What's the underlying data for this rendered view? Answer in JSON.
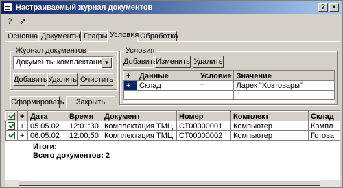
{
  "window": {
    "title": "Настраиваемый журнал документов",
    "help_button": "?",
    "close_button": "×"
  },
  "toolbar": {
    "help_icon_label": "?",
    "pointer_icon_label": "➶"
  },
  "tabs": [
    {
      "label": "Основная"
    },
    {
      "label": "Документы"
    },
    {
      "label": "Графы"
    },
    {
      "label": "Условия"
    },
    {
      "label": "Обработка"
    }
  ],
  "journal_group": {
    "label": "Журнал документов",
    "selected": "Документы комплектации",
    "add_button": "Добавить",
    "delete_button": "Удалить",
    "clear_button": "Очистить"
  },
  "conditions_group": {
    "label": "Условия",
    "add_button": "Добавить",
    "edit_button": "Изменить",
    "delete_button": "Удалить",
    "headers": {
      "marker": "+",
      "data": "Данные",
      "condition": "Условие",
      "value": "Значение"
    },
    "rows": [
      {
        "marker": "+",
        "data": "Склад",
        "condition": "=",
        "value": "Ларек \"Хозтовары\""
      }
    ]
  },
  "actions": {
    "form_button": "Сформировать",
    "close_button": "Закрыть"
  },
  "results": {
    "headers": {
      "plus": "+",
      "date": "Дата",
      "time": "Время",
      "document": "Документ",
      "number": "Номер",
      "kit": "Комплект",
      "warehouse": "Склад"
    },
    "rows": [
      {
        "plus": "+",
        "date": "05.05.02",
        "time": "12:01:30",
        "document": "Комплектация ТМЦ",
        "number": "СТ00000001",
        "kit": "Компьютер",
        "warehouse": "Компл"
      },
      {
        "plus": "+",
        "date": "06.05.02",
        "time": "12:00:50",
        "document": "Комплектация ТМЦ",
        "number": "СТ00000002",
        "kit": "Компьютер",
        "warehouse": "Готова"
      }
    ],
    "totals_label": "Итоги:",
    "total_docs": "Всего документов: 2"
  }
}
